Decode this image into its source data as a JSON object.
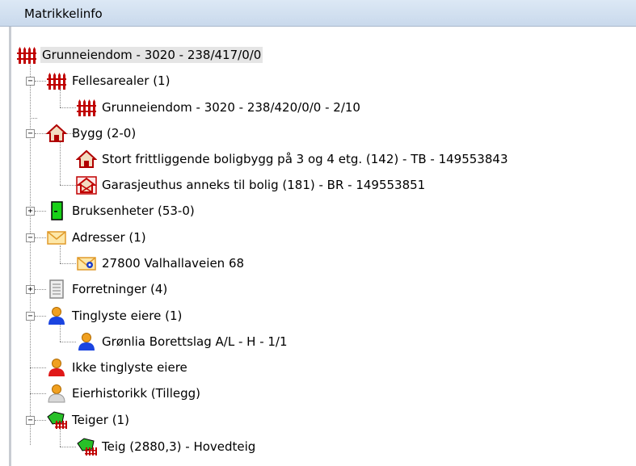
{
  "panel": {
    "title": "Matrikkelinfo"
  },
  "tree": {
    "root": {
      "label": "Grunneiendom - 3020 - 238/417/0/0",
      "icon": "fence-icon"
    },
    "nodes": [
      {
        "label": "Fellesarealer (1)",
        "icon": "fence-icon",
        "expander": "−"
      },
      {
        "label": "Grunneiendom - 3020 - 238/420/0/0 - 2/10",
        "icon": "fence-icon"
      },
      {
        "label": "Bygg (2-0)",
        "icon": "house-icon",
        "expander": "−"
      },
      {
        "label": "Stort frittliggende boligbygg på 3 og 4 etg. (142) - TB - 149553843",
        "icon": "house-icon"
      },
      {
        "label": "Garasjeuthus anneks til bolig (181) - BR - 149553851",
        "icon": "garage-icon"
      },
      {
        "label": "Bruksenheter (53-0)",
        "icon": "door-icon",
        "expander": "+"
      },
      {
        "label": "Adresser (1)",
        "icon": "envelope-icon",
        "expander": "−"
      },
      {
        "label": "27800 Valhallaveien 68",
        "icon": "address-envelope-icon"
      },
      {
        "label": "Forretninger (4)",
        "icon": "document-icon",
        "expander": "+"
      },
      {
        "label": "Tinglyste eiere (1)",
        "icon": "person-blue-icon",
        "expander": "−"
      },
      {
        "label": "Grønlia Borettslag A/L - H - 1/1",
        "icon": "person-blue-icon"
      },
      {
        "label": "Ikke tinglyste eiere",
        "icon": "person-red-icon"
      },
      {
        "label": "Eierhistorikk (Tillegg)",
        "icon": "person-gray-icon"
      },
      {
        "label": "Teiger (1)",
        "icon": "parcel-icon",
        "expander": "−"
      },
      {
        "label": "Teig (2880,3) - Hovedteig",
        "icon": "parcel-icon"
      }
    ]
  },
  "colors": {
    "header_bg": "#c9d9ec",
    "selection": "#e5e5e5",
    "fence": "#c00000"
  }
}
